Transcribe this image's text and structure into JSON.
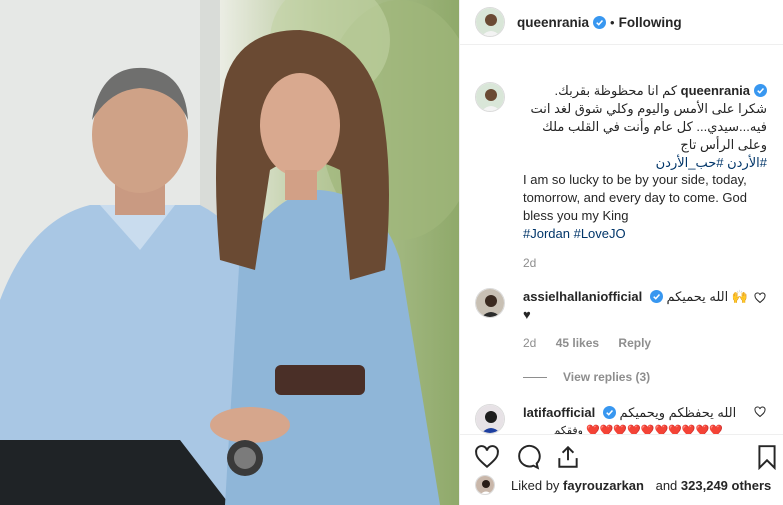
{
  "post": {
    "username": "queenrania",
    "dot": "•",
    "follow_label": "Following"
  },
  "caption": {
    "username": "queenrania",
    "arabic": "كم انا محظوظة بقربك. شكرا على الأمس واليوم وكلي شوق لغد انت فيه...سيدي... كل عام وأنت في القلب ملك وعلى الرأس تاج",
    "arabic_tags": "#الأردن #حب_الأردن",
    "english": "I am so lucky to be by your side, today, tomorrow, and every day to come. God bless you my King",
    "english_tags": "#Jordan #LoveJO",
    "time": "2d"
  },
  "comments": [
    {
      "username": "assielhallaniofficial",
      "text": "الله يحميكم 🙌",
      "text2": "♥",
      "time": "2d",
      "likes": "45 likes",
      "reply_label": "Reply",
      "view_replies": "View replies (3)"
    },
    {
      "username": "latifaofficial",
      "text": "الله يحفظكم ويحميكم",
      "text2": "❤️❤️❤️❤️❤️❤️❤️❤️❤️❤️ وفقكم"
    }
  ],
  "likes_bar": {
    "prefix": "Liked by",
    "liker": "fayrouzarkan",
    "and": "and",
    "count": "323,249 others"
  },
  "icons": [
    "verified-badge-icon",
    "heart-icon",
    "comment-icon",
    "share-icon",
    "bookmark-icon"
  ],
  "colors": {
    "verified": "#3897f0",
    "hashtag": "#003569",
    "muted": "#8e8e8e"
  }
}
